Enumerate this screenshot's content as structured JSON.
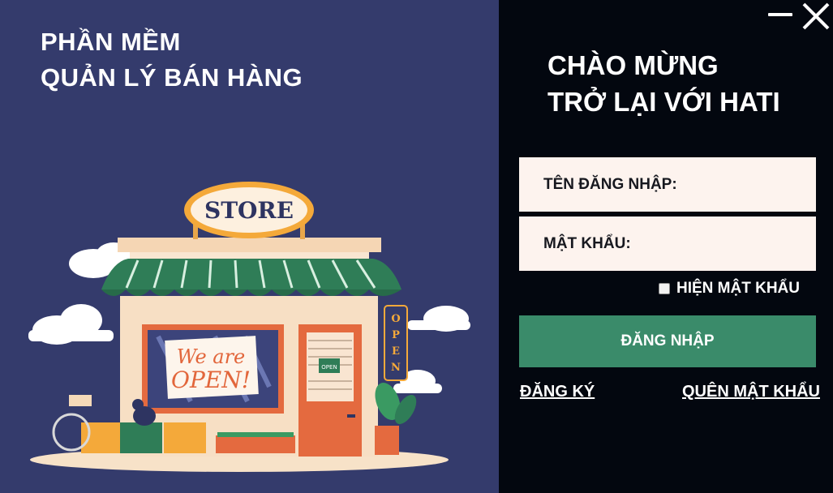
{
  "app_title_line1": "PHẦN MỀM",
  "app_title_line2": "QUẢN LÝ BÁN HÀNG",
  "illustration": {
    "store_sign": "STORE",
    "window_sign_line1": "We are",
    "window_sign_line2": "OPEN!",
    "door_tag": "OPEN",
    "side_sign": [
      "O",
      "P",
      "E",
      "N"
    ]
  },
  "window_controls": {
    "minimize_icon": "minimize-icon",
    "close_icon": "close-icon"
  },
  "welcome_line1": "CHÀO MỪNG",
  "welcome_line2": "TRỞ LẠI VỚI HATI",
  "username": {
    "label": "TÊN ĐĂNG NHẬP:",
    "value": ""
  },
  "password": {
    "label": "MẬT KHẨU:",
    "value": ""
  },
  "show_password_label": "HIỆN MẬT KHẨU",
  "login_button": "ĐĂNG NHẬP",
  "register_link": "ĐĂNG KÝ",
  "forgot_link": "QUÊN MẬT KHẨU",
  "colors": {
    "left_bg": "#343b6c",
    "right_bg": "#03070f",
    "field_bg": "#fdf3ee",
    "login_button_bg": "#3a8b6a"
  }
}
